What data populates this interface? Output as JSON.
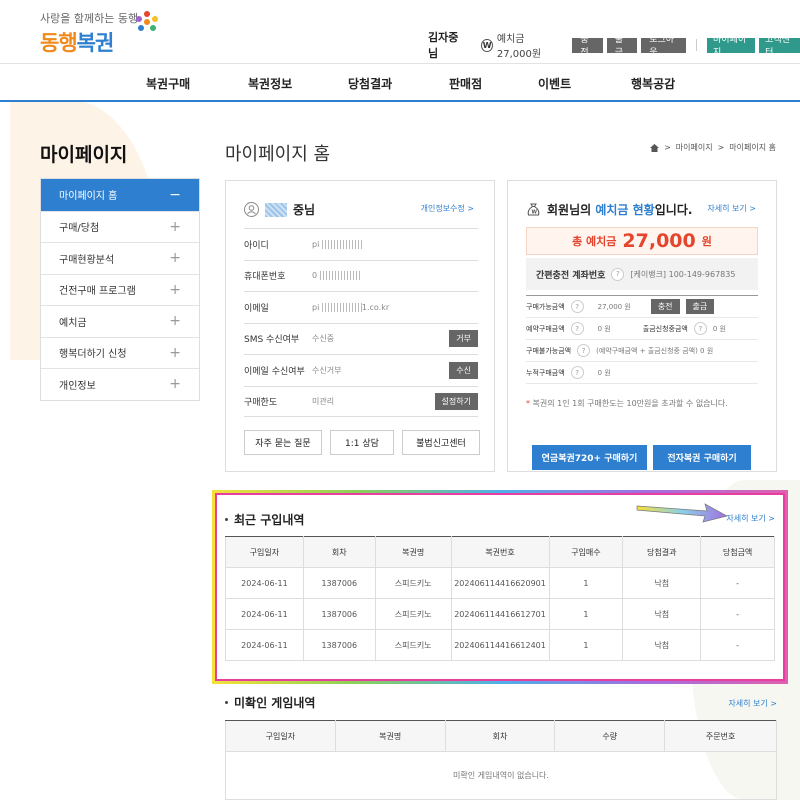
{
  "logo": {
    "tagline": "사랑을 함께하는 동행",
    "name_part1": "동행",
    "name_part2": "복권"
  },
  "user": {
    "name": "김자중님",
    "w_icon": "W",
    "balance_label": "예치금 27,000원"
  },
  "header_buttons": {
    "charge": "충전",
    "withdraw": "출금",
    "logout": "로그아웃",
    "mypage": "마이페이지",
    "support": "고객센터"
  },
  "gnb": [
    "복권구매",
    "복권정보",
    "당첨결과",
    "판매점",
    "이벤트",
    "행복공감"
  ],
  "lnb": {
    "title": "마이페이지",
    "items": [
      {
        "label": "마이페이지 홈",
        "symbol": "−"
      },
      {
        "label": "구매/당첨",
        "symbol": "+"
      },
      {
        "label": "구매현황분석",
        "symbol": "+"
      },
      {
        "label": "건전구매 프로그램",
        "symbol": "+"
      },
      {
        "label": "예치금",
        "symbol": "+"
      },
      {
        "label": "행복더하기 신청",
        "symbol": "+"
      },
      {
        "label": "개인정보",
        "symbol": "+"
      }
    ]
  },
  "page": {
    "title": "마이페이지 홈",
    "breadcrumb": [
      "마이페이지",
      "마이페이지 홈"
    ]
  },
  "info_card": {
    "name_suffix": "중님",
    "edit_link": "개인정보수정 >",
    "rows": [
      {
        "label": "아이디",
        "value": "pi"
      },
      {
        "label": "휴대폰번호",
        "value": "0"
      },
      {
        "label": "이메일",
        "value": "pi",
        "value_tail": "1.co.kr"
      },
      {
        "label": "SMS 수신여부",
        "value": "수신중",
        "button": "거부"
      },
      {
        "label": "이메일 수신여부",
        "value": "수신거부",
        "button": "수신"
      },
      {
        "label": "구매한도",
        "value": "미관리",
        "button": "설정하기"
      }
    ],
    "buttons": [
      "자주 묻는 질문",
      "1:1 상담",
      "불법신고센터"
    ]
  },
  "balance_card": {
    "title_pre": "회원님의 ",
    "title_blue": "예치금 현황",
    "title_post": "입니다.",
    "detail_link": "자세히 보기 >",
    "total_label": "총 예치금",
    "total_amount": "27,000",
    "total_unit": "원",
    "account_label": "간편충전 계좌번호",
    "account_value": "[케이뱅크] 100-149-967835",
    "rows": {
      "available_label": "구매가능금액",
      "available_value": "27,000 원",
      "charge_btn": "충전",
      "withdraw_btn": "출금",
      "reserved_label": "예약구매금액",
      "reserved_value": "0 원",
      "withdraw_req_label": "출금신청중금액",
      "withdraw_req_value": "0 원",
      "unavailable_label": "구매불가능금액",
      "unavailable_value": "(예약구매금액 + 출금신청중 금액)  0 원",
      "cumulative_label": "누적구매금액",
      "cumulative_value": "0 원"
    },
    "note": "복권의 1인 1회 구매한도는 10만원을 초과할 수 없습니다.",
    "note_star": "*",
    "qmark": "?",
    "buttons": [
      "연금복권720+ 구매하기",
      "전자복권 구매하기"
    ]
  },
  "recent": {
    "title": "최근 구입내역",
    "more": "자세히 보기 >",
    "headers": [
      "구입일자",
      "회차",
      "복권명",
      "복권번호",
      "구입매수",
      "당첨결과",
      "당첨금액"
    ],
    "rows": [
      [
        "2024-06-11",
        "1387006",
        "스피드키노",
        "202406114416620901",
        "1",
        "낙첨",
        "-"
      ],
      [
        "2024-06-11",
        "1387006",
        "스피드키노",
        "202406114416612701",
        "1",
        "낙첨",
        "-"
      ],
      [
        "2024-06-11",
        "1387006",
        "스피드키노",
        "202406114416612401",
        "1",
        "낙첨",
        "-"
      ]
    ]
  },
  "unconfirmed": {
    "title": "미확인 게임내역",
    "more": "자세히 보기 >",
    "headers": [
      "구입일자",
      "복권명",
      "회차",
      "수량",
      "주문번호"
    ],
    "empty": "미확인 게임내역이 없습니다."
  },
  "colors": {
    "primary": "#2e7fcf",
    "accent_red": "#e4452c",
    "teal": "#2f9a8c",
    "highlight_border": "#e73ea0"
  }
}
